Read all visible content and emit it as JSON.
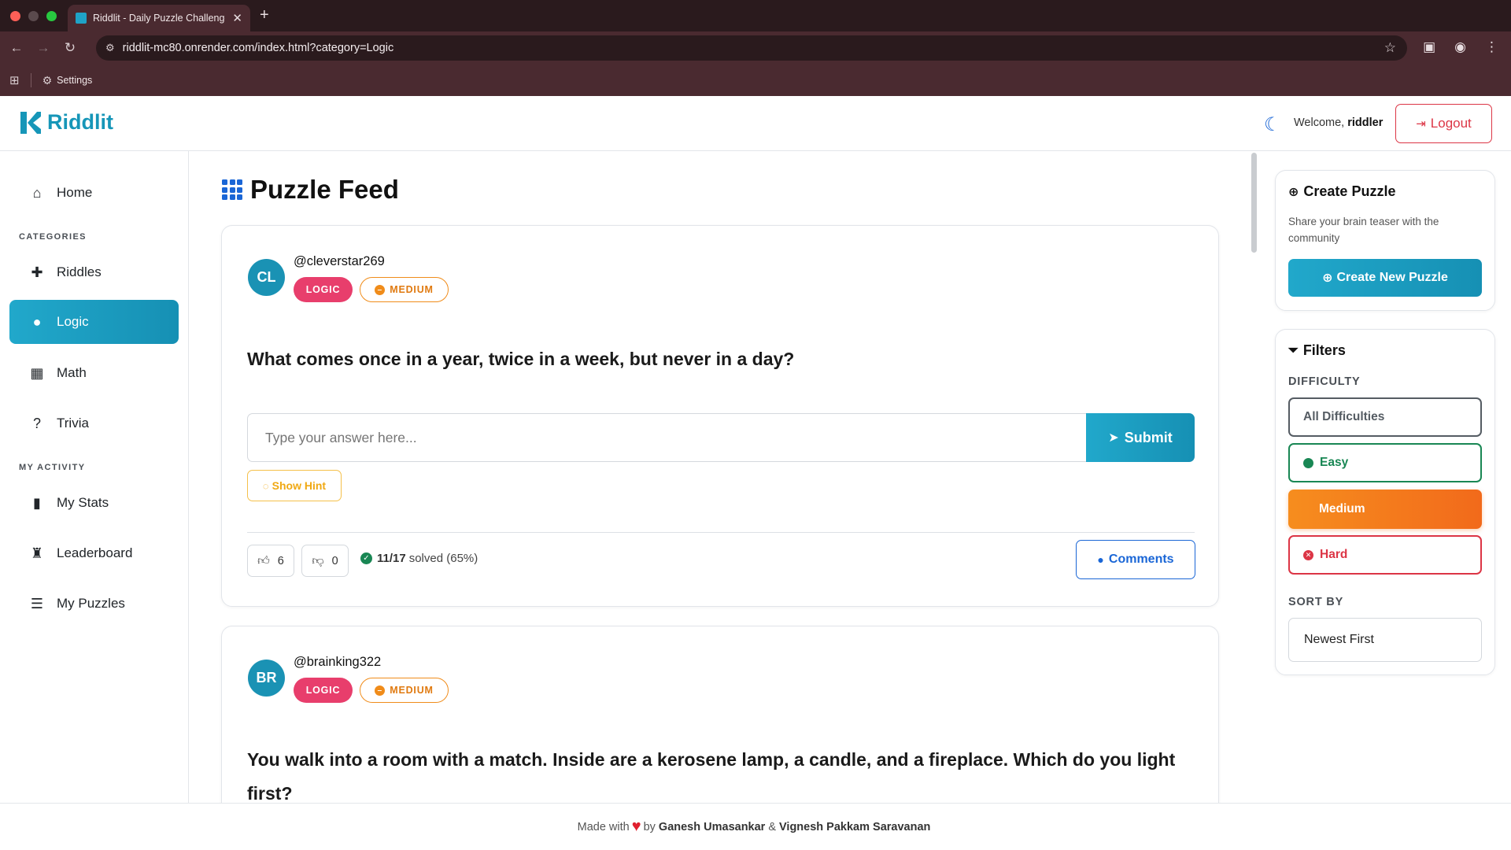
{
  "browser": {
    "tab_title": "Riddlit - Daily Puzzle Challenge",
    "url": "riddlit-mc80.onrender.com/index.html?category=Logic",
    "bookmark_settings": "Settings"
  },
  "header": {
    "brand": "Riddlit",
    "welcome_prefix": "Welcome,",
    "username": "riddler",
    "logout_label": "Logout"
  },
  "sidebar": {
    "home": "Home",
    "categories_heading": "CATEGORIES",
    "categories": [
      {
        "label": "Riddles",
        "icon": "puzzle-icon"
      },
      {
        "label": "Logic",
        "icon": "lightbulb-icon",
        "active": true
      },
      {
        "label": "Math",
        "icon": "calculator-icon"
      },
      {
        "label": "Trivia",
        "icon": "question-circle-icon"
      }
    ],
    "activity_heading": "MY ACTIVITY",
    "activity": [
      {
        "label": "My Stats",
        "icon": "bar-chart-icon"
      },
      {
        "label": "Leaderboard",
        "icon": "trophy-icon"
      },
      {
        "label": "My Puzzles",
        "icon": "journal-icon"
      }
    ]
  },
  "feed": {
    "title": "Puzzle Feed",
    "answer_placeholder": "Type your answer here...",
    "submit_label": "Submit",
    "hint_label": "Show Hint",
    "comments_label": "Comments",
    "posts": [
      {
        "initials": "CL",
        "author": "@cleverstar269",
        "category": "LOGIC",
        "difficulty": "MEDIUM",
        "question": "What comes once in a year, twice in a week, but never in a day?",
        "likes": "6",
        "dislikes": "0",
        "solved_count": "11/17",
        "solved_suffix": "solved (65%)"
      },
      {
        "initials": "BR",
        "author": "@brainking322",
        "category": "LOGIC",
        "difficulty": "MEDIUM",
        "question": "You walk into a room with a match. Inside are a kerosene lamp, a candle, and a fireplace. Which do you light first?"
      }
    ]
  },
  "create_panel": {
    "title": "Create Puzzle",
    "description": "Share your brain teaser with the community",
    "button": "Create New Puzzle"
  },
  "filters": {
    "title": "Filters",
    "difficulty_label": "DIFFICULTY",
    "options": [
      "All Difficulties",
      "Easy",
      "Medium",
      "Hard"
    ],
    "selected": "Medium",
    "sort_label": "SORT BY",
    "sort_value": "Newest First"
  },
  "footer": {
    "made_with": "Made with",
    "by": "by",
    "author1": "Ganesh Umasankar",
    "amp": "&",
    "author2": "Vignesh Pakkam Saravanan"
  },
  "colors": {
    "brand": "#1696b8",
    "accent_blue": "#1a66d6",
    "logic_badge": "#e83e6c",
    "medium": "#f08c1a",
    "easy": "#198754",
    "hard": "#dc3545"
  }
}
